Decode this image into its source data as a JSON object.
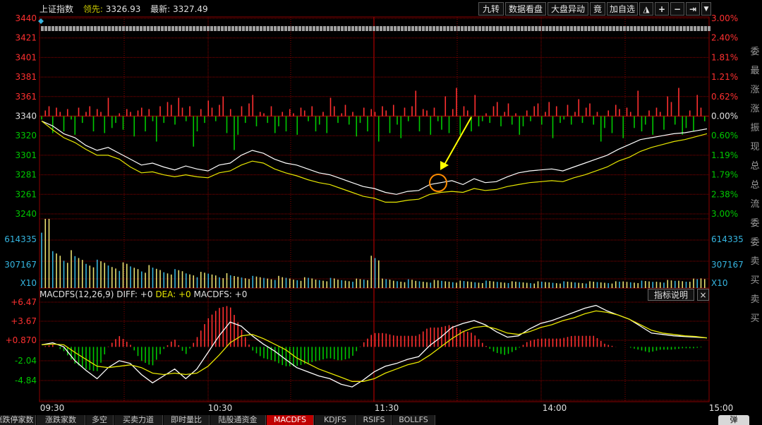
{
  "header": {
    "index_name": "上证指数",
    "lead_label": "领先:",
    "lead_value": "3326.93",
    "latest_label": "最新:",
    "latest_value": "3327.49"
  },
  "toolbar": {
    "nine_turn": "九转",
    "data_view": "数据看盘",
    "market_move": "大盘异动",
    "bid": "竟",
    "add_fav": "加自选",
    "lock_icon": "lock-icon",
    "plus_icon": "plus-icon",
    "minus_icon": "minus-icon",
    "end_icon": "end-icon",
    "dropdown_icon": "chevron-down-icon"
  },
  "price_axis": {
    "left_ticks": [
      "3440",
      "3421",
      "3401",
      "3381",
      "3361",
      "3340",
      "3320",
      "3301",
      "3281",
      "3261",
      "3240"
    ],
    "right_ticks": [
      "3.00%",
      "2.40%",
      "1.81%",
      "1.21%",
      "0.62%",
      "0.00%",
      "0.60%",
      "1.19%",
      "1.79%",
      "2.38%",
      "3.00%"
    ]
  },
  "volume_axis": {
    "left_ticks": [
      "614335",
      "307167",
      "X10"
    ],
    "right_ticks": [
      "614335",
      "307167",
      "X10"
    ]
  },
  "macd": {
    "title": "MACDFS(12,26,9)",
    "diff_label": "DIFF: +0",
    "dea_label": "DEA: +0",
    "macdfs_label": "MACDFS: +0",
    "help_button": "指标说明",
    "close_button": "×",
    "left_ticks": [
      "+6.47",
      "+3.67",
      "+0.870",
      "-2.04",
      "-4.84"
    ]
  },
  "time_axis": [
    "09:30",
    "10:30",
    "11:30",
    "14:00",
    "15:00"
  ],
  "tabs": [
    "涨跌停家数",
    "涨跌家数",
    "多空",
    "买卖力道",
    "即时量比",
    "陆股通资金",
    "MACDFS",
    "KDJFS",
    "RSIFS",
    "BOLLFS"
  ],
  "active_tab": "MACDFS",
  "bottom_button": "弹",
  "side_panel": [
    "委",
    "最",
    "涨",
    "涨",
    "振",
    "现",
    "总",
    "总",
    "流",
    "委",
    "委",
    "卖",
    "买",
    "卖",
    "买"
  ],
  "colors": {
    "up": "#ff3030",
    "down": "#00c800",
    "price_line": "#ffffff",
    "avg_line": "#e6e600",
    "grid": "#8b0000",
    "volume_blue": "#35b5e0",
    "volume_yellow": "#e8e070",
    "annotation_arrow": "#ffff00",
    "annotation_circle": "#ff8c00"
  },
  "chart_data": [
    {
      "type": "line",
      "x_ticks": [
        "09:30",
        "10:30",
        "11:30",
        "14:00",
        "15:00"
      ],
      "series": [
        {
          "values": [
            3335,
            3330,
            3322,
            3318,
            3310,
            3305,
            3308,
            3302,
            3296,
            3290,
            3292,
            3288,
            3285,
            3289,
            3286,
            3284,
            3290,
            3292,
            3300,
            3305,
            3302,
            3296,
            3292,
            3290,
            3286,
            3282,
            3280,
            3276,
            3272,
            3268,
            3266,
            3262,
            3260,
            3263,
            3264,
            3270,
            3272,
            3274,
            3270,
            3276,
            3272,
            3273,
            3278,
            3282,
            3284,
            3285,
            3286,
            3284,
            3288,
            3292,
            3296,
            3300,
            3306,
            3311,
            3316,
            3318,
            3320,
            3322,
            3323,
            3325,
            3327
          ]
        },
        {
          "values": [
            3335,
            3326,
            3318,
            3313,
            3306,
            3300,
            3300,
            3296,
            3288,
            3282,
            3283,
            3280,
            3278,
            3280,
            3278,
            3277,
            3282,
            3284,
            3290,
            3294,
            3292,
            3286,
            3282,
            3279,
            3275,
            3272,
            3270,
            3266,
            3262,
            3258,
            3256,
            3252,
            3252,
            3254,
            3255,
            3260,
            3262,
            3263,
            3262,
            3266,
            3264,
            3265,
            3268,
            3270,
            3272,
            3273,
            3274,
            3273,
            3277,
            3280,
            3284,
            3288,
            3294,
            3298,
            3304,
            3308,
            3311,
            3314,
            3316,
            3319,
            3322
          ]
        }
      ],
      "ylim": [
        3240,
        3440
      ]
    },
    {
      "type": "bar",
      "x_ticks": [
        "09:30",
        "10:30",
        "11:30",
        "14:00",
        "15:00"
      ],
      "ylim": [
        0,
        614335
      ],
      "series": [
        {
          "values": [
            614335,
            307167,
            280000,
            250000,
            230000,
            210000,
            200000,
            190000,
            180000,
            170000,
            160000,
            150000,
            140000,
            130000,
            120000,
            120000,
            110000,
            100000,
            100000,
            90000,
            90000,
            90000,
            85000,
            80000,
            80000,
            75000,
            75000,
            70000,
            70000,
            70000,
            307167,
            70000,
            65000,
            65000,
            60000,
            60000,
            60000,
            60000,
            55000,
            55000,
            55000,
            55000,
            55000,
            50000,
            50000,
            50000,
            50000,
            50000,
            50000,
            50000,
            50000,
            50000,
            50000,
            55000,
            55000,
            55000,
            60000,
            60000,
            65000,
            70000,
            80000
          ]
        }
      ]
    },
    {
      "type": "line",
      "x_ticks": [
        "09:30",
        "10:30",
        "11:30",
        "14:00",
        "15:00"
      ],
      "ylim": [
        -6.47,
        6.47
      ],
      "series": [
        {
          "name": "DIFF",
          "values": [
            0.3,
            0.6,
            0,
            -2.0,
            -3.4,
            -4.6,
            -3.0,
            -2.0,
            -2.4,
            -4.0,
            -5.2,
            -4.2,
            -3.2,
            -4.6,
            -3.2,
            -0.8,
            1.6,
            3.6,
            3.0,
            1.6,
            0.4,
            -0.6,
            -1.8,
            -3.0,
            -3.6,
            -4.2,
            -4.6,
            -5.4,
            -5.8,
            -4.8,
            -3.6,
            -2.8,
            -2.4,
            -1.8,
            -1.4,
            0.2,
            1.4,
            2.8,
            3.4,
            3.8,
            3.2,
            2.2,
            1.4,
            1.6,
            2.6,
            3.4,
            3.8,
            4.4,
            5.0,
            5.6,
            6.0,
            5.2,
            4.6,
            4.0,
            3.0,
            2.0,
            1.8,
            1.6,
            1.5,
            1.4,
            1.3
          ]
        },
        {
          "name": "DEA",
          "values": [
            0.3,
            0.4,
            0.3,
            -0.8,
            -1.8,
            -2.8,
            -3.0,
            -2.8,
            -2.6,
            -3.0,
            -3.8,
            -4.0,
            -3.8,
            -4.0,
            -3.8,
            -2.8,
            -1.2,
            0.6,
            1.6,
            1.8,
            1.2,
            0.4,
            -0.4,
            -1.6,
            -2.4,
            -3.2,
            -3.8,
            -4.4,
            -5.0,
            -5.0,
            -4.6,
            -3.8,
            -3.2,
            -2.6,
            -2.2,
            -1.2,
            0,
            1.2,
            2.2,
            2.8,
            3.0,
            2.6,
            2.0,
            1.8,
            2.2,
            2.8,
            3.2,
            3.8,
            4.2,
            4.8,
            5.2,
            5.0,
            4.6,
            4.0,
            3.2,
            2.4,
            2.0,
            1.8,
            1.6,
            1.5,
            1.3
          ]
        },
        {
          "name": "MACDFS",
          "values": [
            0,
            0.3,
            -0.6,
            -2.4,
            -3.2,
            -3.6,
            0,
            1.6,
            0.4,
            -2.0,
            -2.8,
            -0.4,
            1.2,
            -1.2,
            1.2,
            4.0,
            5.6,
            6.0,
            2.8,
            -0.4,
            -1.6,
            -2.0,
            -2.8,
            -2.8,
            -2.4,
            -2.0,
            -1.6,
            -2.0,
            -1.6,
            0.4,
            2.0,
            2.0,
            1.6,
            1.6,
            1.6,
            2.8,
            2.8,
            3.2,
            2.4,
            2.0,
            0.4,
            -0.8,
            -1.2,
            -0.4,
            0.8,
            1.2,
            1.2,
            1.2,
            1.6,
            1.6,
            1.6,
            0.4,
            0,
            0,
            -0.4,
            -0.8,
            -0.4,
            -0.4,
            -0.2,
            -0.2,
            0
          ]
        }
      ]
    }
  ]
}
